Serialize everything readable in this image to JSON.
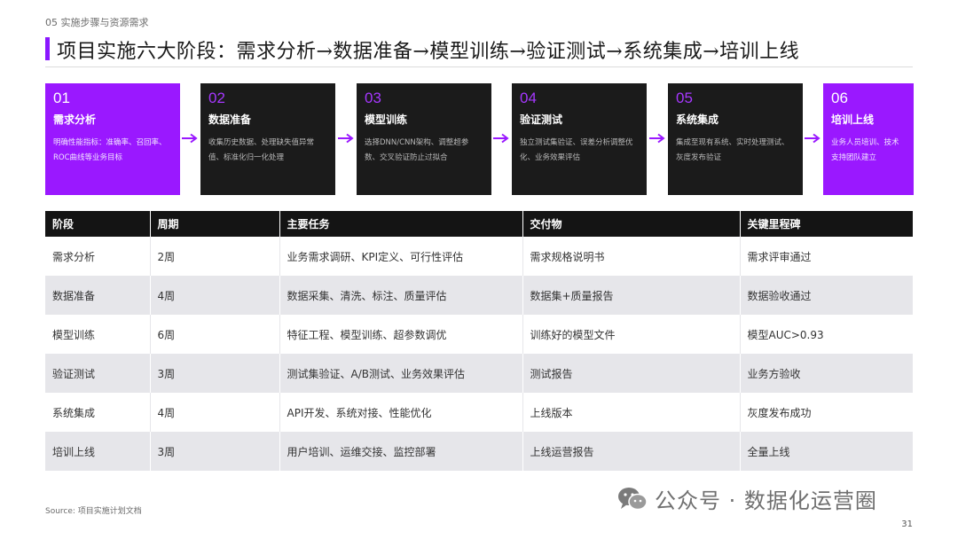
{
  "section": "05 实施步骤与资源需求",
  "title": "项目实施六大阶段：需求分析→数据准备→模型训练→验证测试→系统集成→培训上线",
  "stages": [
    {
      "num": "01",
      "name": "需求分析",
      "desc": "明确性能指标：准确率、召回率、ROC曲线等业务目标",
      "style": "purple"
    },
    {
      "num": "02",
      "name": "数据准备",
      "desc": "收集历史数据、处理缺失值异常值、标准化归一化处理",
      "style": "dark"
    },
    {
      "num": "03",
      "name": "模型训练",
      "desc": "选择DNN/CNN架构、调整超参数、交叉验证防止过拟合",
      "style": "dark"
    },
    {
      "num": "04",
      "name": "验证测试",
      "desc": "独立测试集验证、误差分析调整优化、业务效果评估",
      "style": "dark"
    },
    {
      "num": "05",
      "name": "系统集成",
      "desc": "集成至现有系统、实时处理测试、灰度发布验证",
      "style": "dark"
    },
    {
      "num": "06",
      "name": "培训上线",
      "desc": "业务人员培训、技术支持团队建立",
      "style": "purple"
    }
  ],
  "table": {
    "headers": [
      "阶段",
      "周期",
      "主要任务",
      "交付物",
      "关键里程碑"
    ],
    "rows": [
      [
        "需求分析",
        "2周",
        "业务需求调研、KPI定义、可行性评估",
        "需求规格说明书",
        "需求评审通过"
      ],
      [
        "数据准备",
        "4周",
        "数据采集、清洗、标注、质量评估",
        "数据集+质量报告",
        "数据验收通过"
      ],
      [
        "模型训练",
        "6周",
        "特征工程、模型训练、超参数调优",
        "训练好的模型文件",
        "模型AUC>0.93"
      ],
      [
        "验证测试",
        "3周",
        "测试集验证、A/B测试、业务效果评估",
        "测试报告",
        "业务方验收"
      ],
      [
        "系统集成",
        "4周",
        "API开发、系统对接、性能优化",
        "上线版本",
        "灰度发布成功"
      ],
      [
        "培训上线",
        "3周",
        "用户培训、运维交接、监控部署",
        "上线运营报告",
        "全量上线"
      ]
    ]
  },
  "source": "Source: 项目实施计划文档",
  "watermark": "公众号 · 数据化运营圈",
  "page_number": "31",
  "colors": {
    "accent": "#9a18ff",
    "dark": "#1b1b1b",
    "header": "#141414",
    "stripe": "#e6e6ea"
  }
}
